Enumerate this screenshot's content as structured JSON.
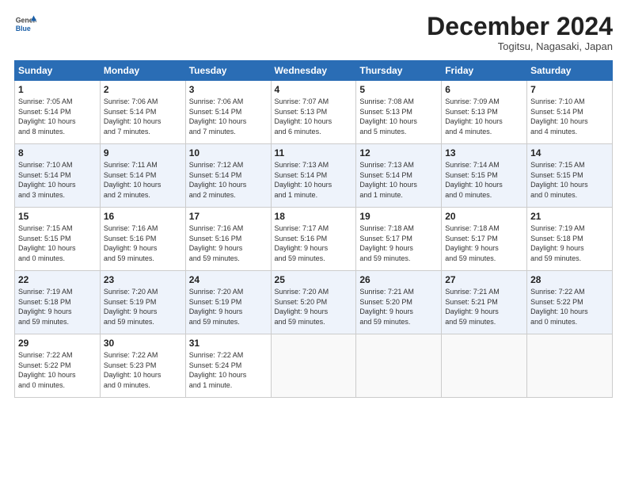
{
  "header": {
    "logo_general": "General",
    "logo_blue": "Blue",
    "month_title": "December 2024",
    "location": "Togitsu, Nagasaki, Japan"
  },
  "weekdays": [
    "Sunday",
    "Monday",
    "Tuesday",
    "Wednesday",
    "Thursday",
    "Friday",
    "Saturday"
  ],
  "weeks": [
    [
      {
        "day": "1",
        "lines": [
          "Sunrise: 7:05 AM",
          "Sunset: 5:14 PM",
          "Daylight: 10 hours",
          "and 8 minutes."
        ]
      },
      {
        "day": "2",
        "lines": [
          "Sunrise: 7:06 AM",
          "Sunset: 5:14 PM",
          "Daylight: 10 hours",
          "and 7 minutes."
        ]
      },
      {
        "day": "3",
        "lines": [
          "Sunrise: 7:06 AM",
          "Sunset: 5:14 PM",
          "Daylight: 10 hours",
          "and 7 minutes."
        ]
      },
      {
        "day": "4",
        "lines": [
          "Sunrise: 7:07 AM",
          "Sunset: 5:13 PM",
          "Daylight: 10 hours",
          "and 6 minutes."
        ]
      },
      {
        "day": "5",
        "lines": [
          "Sunrise: 7:08 AM",
          "Sunset: 5:13 PM",
          "Daylight: 10 hours",
          "and 5 minutes."
        ]
      },
      {
        "day": "6",
        "lines": [
          "Sunrise: 7:09 AM",
          "Sunset: 5:13 PM",
          "Daylight: 10 hours",
          "and 4 minutes."
        ]
      },
      {
        "day": "7",
        "lines": [
          "Sunrise: 7:10 AM",
          "Sunset: 5:14 PM",
          "Daylight: 10 hours",
          "and 4 minutes."
        ]
      }
    ],
    [
      {
        "day": "8",
        "lines": [
          "Sunrise: 7:10 AM",
          "Sunset: 5:14 PM",
          "Daylight: 10 hours",
          "and 3 minutes."
        ]
      },
      {
        "day": "9",
        "lines": [
          "Sunrise: 7:11 AM",
          "Sunset: 5:14 PM",
          "Daylight: 10 hours",
          "and 2 minutes."
        ]
      },
      {
        "day": "10",
        "lines": [
          "Sunrise: 7:12 AM",
          "Sunset: 5:14 PM",
          "Daylight: 10 hours",
          "and 2 minutes."
        ]
      },
      {
        "day": "11",
        "lines": [
          "Sunrise: 7:13 AM",
          "Sunset: 5:14 PM",
          "Daylight: 10 hours",
          "and 1 minute."
        ]
      },
      {
        "day": "12",
        "lines": [
          "Sunrise: 7:13 AM",
          "Sunset: 5:14 PM",
          "Daylight: 10 hours",
          "and 1 minute."
        ]
      },
      {
        "day": "13",
        "lines": [
          "Sunrise: 7:14 AM",
          "Sunset: 5:15 PM",
          "Daylight: 10 hours",
          "and 0 minutes."
        ]
      },
      {
        "day": "14",
        "lines": [
          "Sunrise: 7:15 AM",
          "Sunset: 5:15 PM",
          "Daylight: 10 hours",
          "and 0 minutes."
        ]
      }
    ],
    [
      {
        "day": "15",
        "lines": [
          "Sunrise: 7:15 AM",
          "Sunset: 5:15 PM",
          "Daylight: 10 hours",
          "and 0 minutes."
        ]
      },
      {
        "day": "16",
        "lines": [
          "Sunrise: 7:16 AM",
          "Sunset: 5:16 PM",
          "Daylight: 9 hours",
          "and 59 minutes."
        ]
      },
      {
        "day": "17",
        "lines": [
          "Sunrise: 7:16 AM",
          "Sunset: 5:16 PM",
          "Daylight: 9 hours",
          "and 59 minutes."
        ]
      },
      {
        "day": "18",
        "lines": [
          "Sunrise: 7:17 AM",
          "Sunset: 5:16 PM",
          "Daylight: 9 hours",
          "and 59 minutes."
        ]
      },
      {
        "day": "19",
        "lines": [
          "Sunrise: 7:18 AM",
          "Sunset: 5:17 PM",
          "Daylight: 9 hours",
          "and 59 minutes."
        ]
      },
      {
        "day": "20",
        "lines": [
          "Sunrise: 7:18 AM",
          "Sunset: 5:17 PM",
          "Daylight: 9 hours",
          "and 59 minutes."
        ]
      },
      {
        "day": "21",
        "lines": [
          "Sunrise: 7:19 AM",
          "Sunset: 5:18 PM",
          "Daylight: 9 hours",
          "and 59 minutes."
        ]
      }
    ],
    [
      {
        "day": "22",
        "lines": [
          "Sunrise: 7:19 AM",
          "Sunset: 5:18 PM",
          "Daylight: 9 hours",
          "and 59 minutes."
        ]
      },
      {
        "day": "23",
        "lines": [
          "Sunrise: 7:20 AM",
          "Sunset: 5:19 PM",
          "Daylight: 9 hours",
          "and 59 minutes."
        ]
      },
      {
        "day": "24",
        "lines": [
          "Sunrise: 7:20 AM",
          "Sunset: 5:19 PM",
          "Daylight: 9 hours",
          "and 59 minutes."
        ]
      },
      {
        "day": "25",
        "lines": [
          "Sunrise: 7:20 AM",
          "Sunset: 5:20 PM",
          "Daylight: 9 hours",
          "and 59 minutes."
        ]
      },
      {
        "day": "26",
        "lines": [
          "Sunrise: 7:21 AM",
          "Sunset: 5:20 PM",
          "Daylight: 9 hours",
          "and 59 minutes."
        ]
      },
      {
        "day": "27",
        "lines": [
          "Sunrise: 7:21 AM",
          "Sunset: 5:21 PM",
          "Daylight: 9 hours",
          "and 59 minutes."
        ]
      },
      {
        "day": "28",
        "lines": [
          "Sunrise: 7:22 AM",
          "Sunset: 5:22 PM",
          "Daylight: 10 hours",
          "and 0 minutes."
        ]
      }
    ],
    [
      {
        "day": "29",
        "lines": [
          "Sunrise: 7:22 AM",
          "Sunset: 5:22 PM",
          "Daylight: 10 hours",
          "and 0 minutes."
        ]
      },
      {
        "day": "30",
        "lines": [
          "Sunrise: 7:22 AM",
          "Sunset: 5:23 PM",
          "Daylight: 10 hours",
          "and 0 minutes."
        ]
      },
      {
        "day": "31",
        "lines": [
          "Sunrise: 7:22 AM",
          "Sunset: 5:24 PM",
          "Daylight: 10 hours",
          "and 1 minute."
        ]
      },
      null,
      null,
      null,
      null
    ]
  ]
}
